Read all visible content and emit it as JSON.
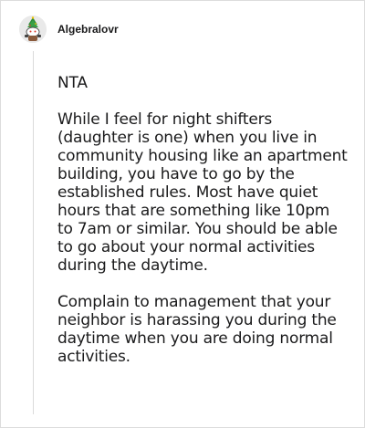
{
  "comment": {
    "username": "Algebralovr",
    "avatar_icon": "snoo-avatar-icon",
    "paragraphs": [
      "NTA",
      "While I feel for night shifters (daughter is one) when you live in community housing like an apartment building, you have to go by the established rules. Most have quiet hours that are something like 10pm to 7am or similar. You should be able to go about your normal activities during the daytime.",
      "Complain to management that your neighbor is harassing you during the daytime when you are doing normal activities."
    ]
  },
  "colors": {
    "text": "#1a1a1b",
    "thread_line": "#dadada",
    "border": "#dcdcdc"
  }
}
